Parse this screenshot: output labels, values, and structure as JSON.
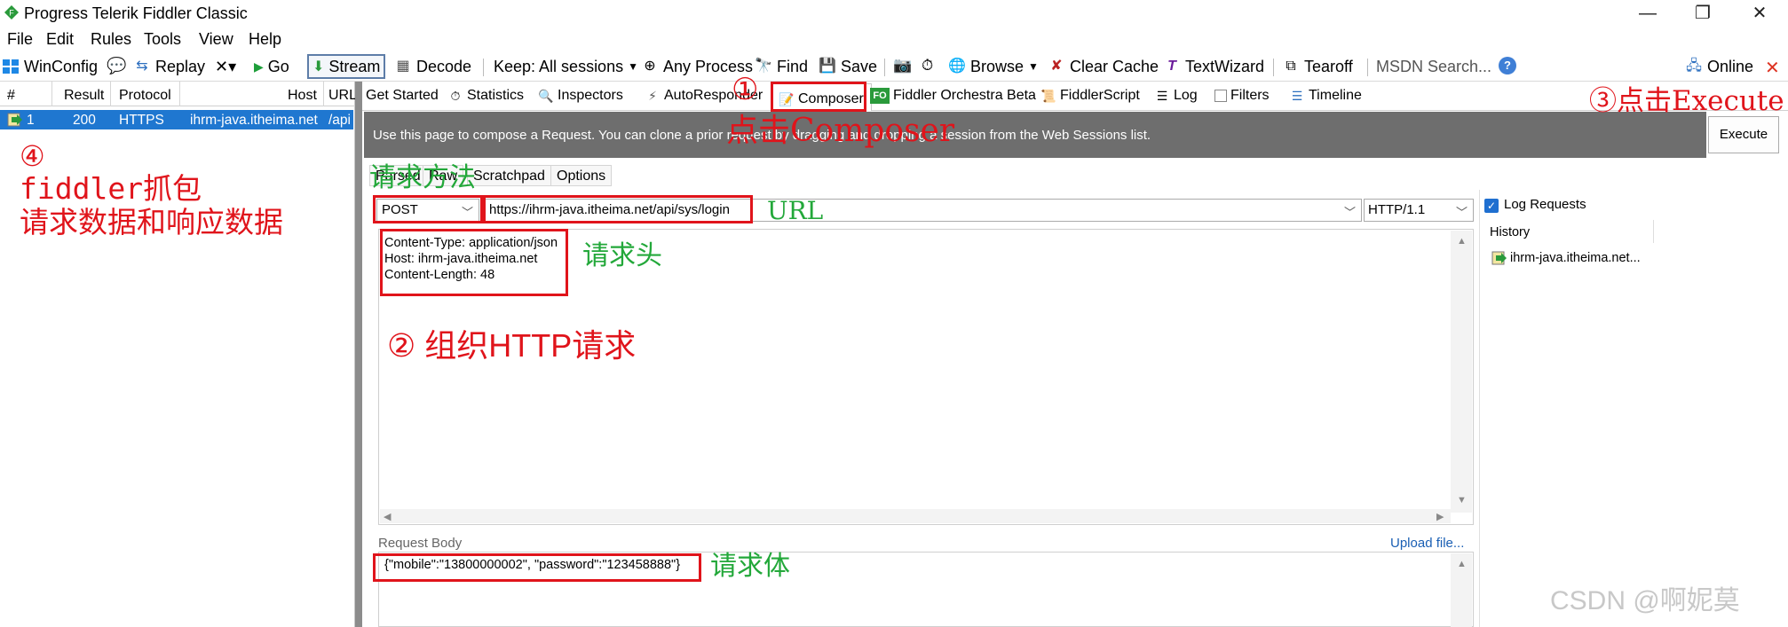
{
  "window": {
    "title": "Progress Telerik Fiddler Classic",
    "controls": {
      "minimize": "—",
      "restore": "❐",
      "close": "✕"
    }
  },
  "menu": [
    "File",
    "Edit",
    "Rules",
    "Tools",
    "View",
    "Help"
  ],
  "toolbar": {
    "winconfig": "WinConfig",
    "replay": "Replay",
    "remove": "✕▾",
    "go": "Go",
    "stream": "Stream",
    "decode": "Decode",
    "keep": "Keep: All sessions",
    "any_process": "Any Process",
    "find": "Find",
    "save": "Save",
    "browse": "Browse",
    "clear_cache": "Clear Cache",
    "textwizard": "TextWizard",
    "tearoff": "Tearoff",
    "msdn_search": "MSDN Search...",
    "online": "Online"
  },
  "sessions": {
    "columns": [
      "#",
      "Result",
      "Protocol",
      "Host",
      "URL"
    ],
    "rows": [
      {
        "num": "1",
        "result": "200",
        "protocol": "HTTPS",
        "host": "ihrm-java.itheima.net",
        "url": "/api"
      }
    ]
  },
  "tabs": [
    "Get Started",
    "Statistics",
    "Inspectors",
    "AutoResponder",
    "Composer",
    "Fiddler Orchestra Beta",
    "FiddlerScript",
    "Log",
    "Filters",
    "Timeline"
  ],
  "composer": {
    "banner": "Use this page to compose a Request. You can clone a prior request by dragging and dropping a session from the Web Sessions list.",
    "execute": "Execute",
    "subtabs": [
      "Parsed",
      "Raw",
      "Scratchpad",
      "Options"
    ],
    "method": "POST",
    "url": "https://ihrm-java.itheima.net/api/sys/login",
    "http_version": "HTTP/1.1",
    "headers": "Content-Type: application/json\nHost: ihrm-java.itheima.net\nContent-Length: 48",
    "body_label": "Request Body",
    "upload": "Upload file...",
    "body": "{\"mobile\":\"13800000002\", \"password\":\"123458888\"}",
    "log_requests": "Log Requests",
    "history_label": "History",
    "history_items": [
      "ihrm-java.itheima.net..."
    ]
  },
  "annotations": {
    "step1_num": "①",
    "step1_text": "点击Composer",
    "step2": "② 组织HTTP请求",
    "step3": "③点击Execute",
    "step4_num": "④",
    "step4_line1": "fiddler抓包",
    "step4_line2": "请求数据和响应数据",
    "method": "请求方法",
    "url": "URL",
    "headers": "请求头",
    "body": "请求体"
  },
  "watermark": "CSDN @啊妮莫",
  "colors": {
    "annotation_red": "#e0141b",
    "annotation_green": "#23a83a",
    "selection_blue": "#1f77d0",
    "banner_gray": "#6e6e6e"
  }
}
